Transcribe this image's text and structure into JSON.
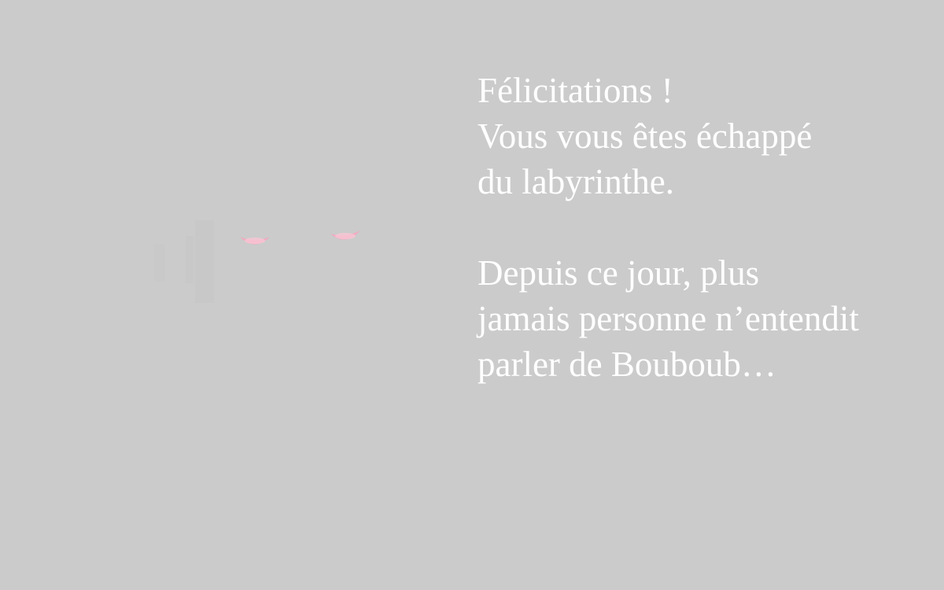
{
  "ending": {
    "title": "Félicitations !",
    "paragraph1": [
      "Félicitations !",
      "Vous vous êtes échappé",
      "du labyrinthe."
    ],
    "paragraph2": [
      "Depuis ce jour, plus",
      "jamais personne n’entendit",
      "parler de Bouboub…"
    ]
  },
  "colors": {
    "background": "#cbcbcb",
    "text": "#ffffff",
    "eyes": "#f2a9bf"
  },
  "icons": {
    "creature": "glowing-eyes-in-darkness"
  }
}
